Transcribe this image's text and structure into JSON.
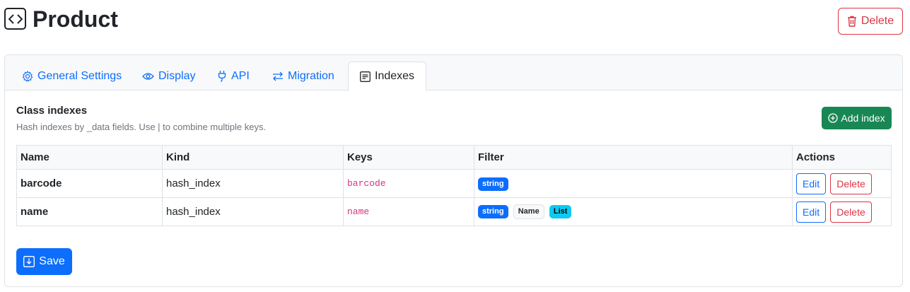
{
  "header": {
    "title": "Product",
    "delete_label": "Delete"
  },
  "tabs": [
    {
      "label": "General Settings",
      "icon": "gear-icon",
      "active": false
    },
    {
      "label": "Display",
      "icon": "eye-icon",
      "active": false
    },
    {
      "label": "API",
      "icon": "plug-icon",
      "active": false
    },
    {
      "label": "Migration",
      "icon": "arrows-exchange-icon",
      "active": false
    },
    {
      "label": "Indexes",
      "icon": "list-icon",
      "active": true
    }
  ],
  "section": {
    "title": "Class indexes",
    "description": "Hash indexes by _data fields. Use | to combine multiple keys.",
    "add_label": "Add index"
  },
  "table": {
    "headers": [
      "Name",
      "Kind",
      "Keys",
      "Filter",
      "Actions"
    ],
    "rows": [
      {
        "name": "barcode",
        "kind": "hash_index",
        "keys": "barcode",
        "filters": [
          {
            "text": "string",
            "style": "primary"
          }
        ],
        "edit_label": "Edit",
        "delete_label": "Delete"
      },
      {
        "name": "name",
        "kind": "hash_index",
        "keys": "name",
        "filters": [
          {
            "text": "string",
            "style": "primary"
          },
          {
            "text": "Name",
            "style": "light"
          },
          {
            "text": "List",
            "style": "info"
          }
        ],
        "edit_label": "Edit",
        "delete_label": "Delete"
      }
    ]
  },
  "footer": {
    "save_label": "Save"
  },
  "colors": {
    "primary": "#0d6efd",
    "danger": "#dc3545",
    "success": "#198754",
    "info": "#0dcaf0"
  }
}
